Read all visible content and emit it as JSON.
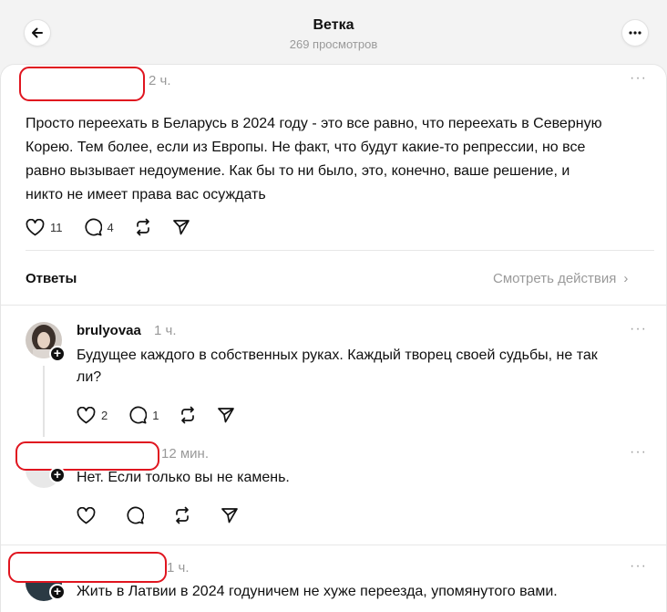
{
  "header": {
    "title": "Ветка",
    "views": "269 просмотров"
  },
  "icons": {
    "back": "arrow-left-icon",
    "menu": "more-horizontal-icon",
    "like": "heart-icon",
    "reply": "comment-bubble-icon",
    "repost": "repost-icon",
    "share": "send-icon",
    "follow": "plus-icon"
  },
  "main_post": {
    "author_redacted": true,
    "time": "2 ч.",
    "text_lines": [
      "Просто переехать в Беларусь в 2024 году - это все равно, что переехать в Северную",
      "Корею. Тем более, если из Европы. Не факт, что будут какие-то репрессии, но все",
      "равно вызывает недоумение. Как бы то ни было, это, конечно, ваше решение, и",
      "никто не имеет права вас осуждать"
    ],
    "likes": "11",
    "replies": "4"
  },
  "replies_bar": {
    "label": "Ответы",
    "view_activity": "Смотреть действия",
    "chevron": "›"
  },
  "reply1": {
    "username": "brulyovaa",
    "time": "1 ч.",
    "text_lines": [
      "Будущее каждого в собственных руках. Каждый творец своей судьбы, не так",
      "ли?"
    ],
    "likes": "2",
    "replies": "1"
  },
  "reply2": {
    "author_redacted": true,
    "time": "12 мин.",
    "text": "Нет. Если только вы не камень."
  },
  "reply3": {
    "author_redacted": true,
    "time": "1 ч.",
    "text": "Жить в Латвии в 2024 годуничем не хуже переезда, упомянутого вами."
  },
  "colors": {
    "redaction": "#e0151f",
    "text": "#101010",
    "muted": "#999999"
  }
}
